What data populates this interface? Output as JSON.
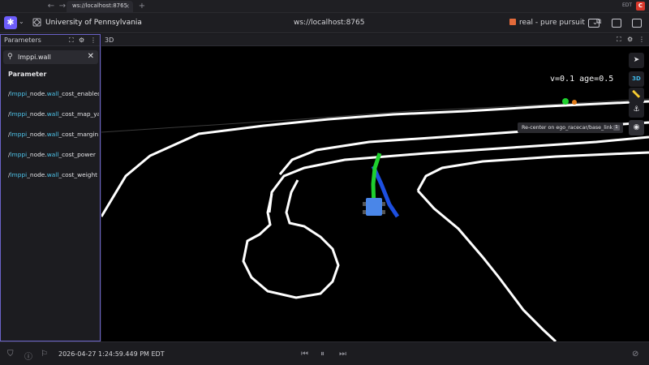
{
  "browser": {
    "tab_title": "ws://localhost:8765",
    "tab_close": "×",
    "new_tab": "+",
    "timezone_badge": "EDT",
    "profile_badge": "C"
  },
  "appbar": {
    "organization": "University of Pennsylvania",
    "connection": "ws://localhost:8765",
    "layout_name": "real - pure pursuit",
    "layout_chevron": "⌄",
    "accent_color": "#6d5dfc"
  },
  "parameters_panel": {
    "title": "Parameters",
    "search_value": "lmppi.wall",
    "column_header": "Parameter",
    "rows": [
      {
        "prefix": "/",
        "match1": "lmppi",
        "mid": "_node.",
        "match2": "wall",
        "suffix": "_cost_enabled"
      },
      {
        "prefix": "/",
        "match1": "lmppi",
        "mid": "_node.",
        "match2": "wall",
        "suffix": "_cost_map_yam"
      },
      {
        "prefix": "/",
        "match1": "lmppi",
        "mid": "_node.",
        "match2": "wall",
        "suffix": "_cost_margin"
      },
      {
        "prefix": "/",
        "match1": "lmppi",
        "mid": "_node.",
        "match2": "wall",
        "suffix": "_cost_power"
      },
      {
        "prefix": "/",
        "match1": "lmppi",
        "mid": "_node.",
        "match2": "wall",
        "suffix": "_cost_weight"
      }
    ],
    "highlight_color": "#4cc2e8"
  },
  "panel_3d": {
    "title": "3D",
    "overlay_text": "v=0.1 age=0.5",
    "tooltip": "Re-center on ego_racecar/base_link",
    "tooltip_key": "1",
    "tool_3d_label": "3D"
  },
  "bottombar": {
    "timestamp": "2026-04-27 1:24:59.449 PM EDT"
  }
}
